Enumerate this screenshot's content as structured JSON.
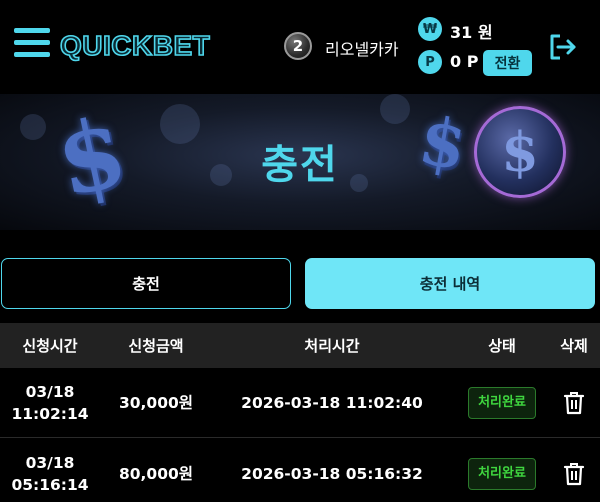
{
  "header": {
    "logo": "QUICKBET",
    "level": "2",
    "username": "리오넬카카",
    "money_icon": "₩",
    "money_value": "31 원",
    "point_icon": "P",
    "point_value": "0 P",
    "convert_label": "전환"
  },
  "banner": {
    "title": "충전"
  },
  "tabs": {
    "charge": "충전",
    "history": "충전 내역"
  },
  "table": {
    "headers": [
      "신청시간",
      "신청금액",
      "처리시간",
      "상태",
      "삭제"
    ],
    "rows": [
      {
        "date": "03/18",
        "time": "11:02:14",
        "amount": "30,000원",
        "processed": "2026-03-18 11:02:40",
        "status": "처리완료"
      },
      {
        "date": "03/18",
        "time": "05:16:14",
        "amount": "80,000원",
        "processed": "2026-03-18 05:16:32",
        "status": "처리완료"
      }
    ]
  },
  "colors": {
    "accent": "#4fd7ec",
    "status_green": "#3fd63f"
  }
}
